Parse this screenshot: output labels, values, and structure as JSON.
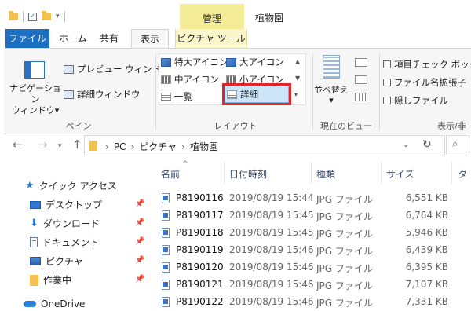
{
  "title_bar": {
    "context_tab": "管理",
    "window_title": "植物園"
  },
  "tabs": {
    "file": "ファイル",
    "home": "ホーム",
    "share": "共有",
    "view": "表示",
    "picture_tools": "ピクチャ ツール"
  },
  "ribbon": {
    "pane": {
      "nav_pane_line1": "ナビゲーション",
      "nav_pane_line2": "ウィンドウ▾",
      "preview_pane": "プレビュー ウィンドウ",
      "details_pane": "詳細ウィンドウ",
      "label": "ペイン"
    },
    "layout": {
      "xl_icons": "特大アイコン",
      "large_icons": "大アイコン",
      "medium_icons": "中アイコン",
      "small_icons": "小アイコン",
      "list": "一覧",
      "details": "詳細",
      "label": "レイアウト"
    },
    "current_view": {
      "sort_line1": "並べ替え",
      "sort_line2": "▾",
      "label": "現在のビュー"
    },
    "show_hide": {
      "item_checkboxes": "項目チェック ボックス",
      "file_extensions": "ファイル名拡張子",
      "hidden_items": "隠しファイル",
      "label": "表示/非"
    }
  },
  "address": {
    "crumbs": [
      "PC",
      "ピクチャ",
      "植物園"
    ]
  },
  "nav_pane": {
    "quick_access": "クイック アクセス",
    "items": [
      "デスクトップ",
      "ダウンロード",
      "ドキュメント",
      "ピクチャ",
      "作業中"
    ],
    "onedrive": "OneDrive"
  },
  "file_list": {
    "columns": [
      "名前",
      "日付時刻",
      "種類",
      "サイズ",
      "タ"
    ],
    "rows": [
      {
        "name": "P8190116",
        "date": "2019/08/19 15:44",
        "type": "JPG ファイル",
        "size": "6,551 KB"
      },
      {
        "name": "P8190117",
        "date": "2019/08/19 15:45",
        "type": "JPG ファイル",
        "size": "6,764 KB"
      },
      {
        "name": "P8190118",
        "date": "2019/08/19 15:45",
        "type": "JPG ファイル",
        "size": "5,946 KB"
      },
      {
        "name": "P8190119",
        "date": "2019/08/19 15:46",
        "type": "JPG ファイル",
        "size": "6,439 KB"
      },
      {
        "name": "P8190120",
        "date": "2019/08/19 15:46",
        "type": "JPG ファイル",
        "size": "6,395 KB"
      },
      {
        "name": "P8190121",
        "date": "2019/08/19 15:46",
        "type": "JPG ファイル",
        "size": "7,107 KB"
      },
      {
        "name": "P8190122",
        "date": "2019/08/19 15:46",
        "type": "JPG ファイル",
        "size": "7,331 KB"
      }
    ]
  },
  "colors": {
    "file_tab": "#1a6fc2",
    "context_highlight": "#f5ec97",
    "selection_outline": "#e0262b"
  }
}
